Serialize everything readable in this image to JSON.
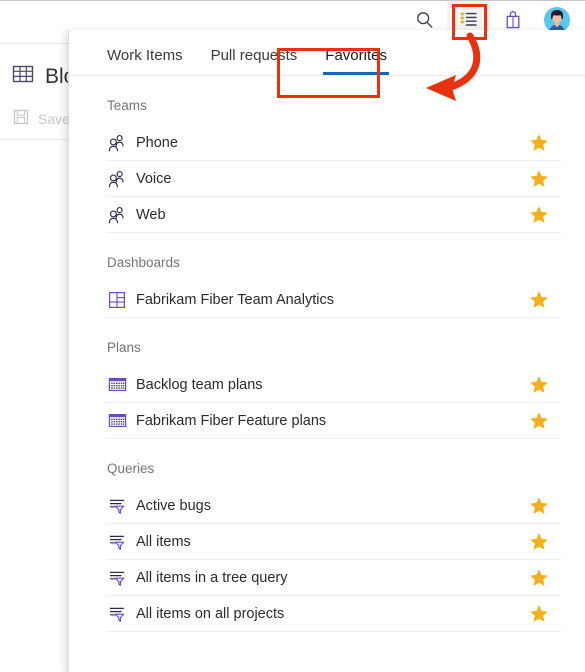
{
  "app": {
    "background_page": {
      "query_title": "Bloc",
      "query_title_icon": "query-table-icon",
      "save_label": "Save",
      "save_icon": "save-floppy-icon"
    },
    "toolbar": {
      "items": [
        {
          "name": "search-icon",
          "label": "Search",
          "active": false
        },
        {
          "name": "favorites-list-icon",
          "label": "Favorites",
          "active": true
        },
        {
          "name": "marketplace-bag-icon",
          "label": "Marketplace",
          "active": false
        },
        {
          "name": "user-avatar",
          "label": "User profile",
          "active": false
        }
      ]
    }
  },
  "panel": {
    "tabs": [
      {
        "label": "Work Items",
        "selected": false
      },
      {
        "label": "Pull requests",
        "selected": false
      },
      {
        "label": "Favorites",
        "selected": true
      }
    ],
    "sections": [
      {
        "header": "Teams",
        "icon": "team-people-icon",
        "items": [
          {
            "label": "Phone",
            "favorited": true
          },
          {
            "label": "Voice",
            "favorited": true
          },
          {
            "label": "Web",
            "favorited": true
          }
        ]
      },
      {
        "header": "Dashboards",
        "icon": "dashboard-grid-icon",
        "items": [
          {
            "label": "Fabrikam Fiber Team Analytics",
            "favorited": true
          }
        ]
      },
      {
        "header": "Plans",
        "icon": "plan-calendar-icon",
        "items": [
          {
            "label": "Backlog team plans",
            "favorited": true
          },
          {
            "label": "Fabrikam Fiber Feature plans",
            "favorited": true
          }
        ]
      },
      {
        "header": "Queries",
        "icon": "query-filter-icon",
        "items": [
          {
            "label": "Active bugs",
            "favorited": true
          },
          {
            "label": "All items",
            "favorited": true
          },
          {
            "label": "All items in a tree query",
            "favorited": true
          },
          {
            "label": "All items on all projects",
            "favorited": true
          }
        ]
      }
    ]
  },
  "colors": {
    "star_gold": "#F2B01E",
    "tab_underline_blue": "#0F6CBD",
    "annotation_red": "#E8320E",
    "section_header_gray": "#767676",
    "item_text": "#2B2B2B"
  },
  "annotations": {
    "callout_icon_label": "favorites-list-icon highlight",
    "callout_tab_label": "Favorites tab highlight",
    "arrow_label": "arrow from favorites icon to Favorites tab"
  }
}
